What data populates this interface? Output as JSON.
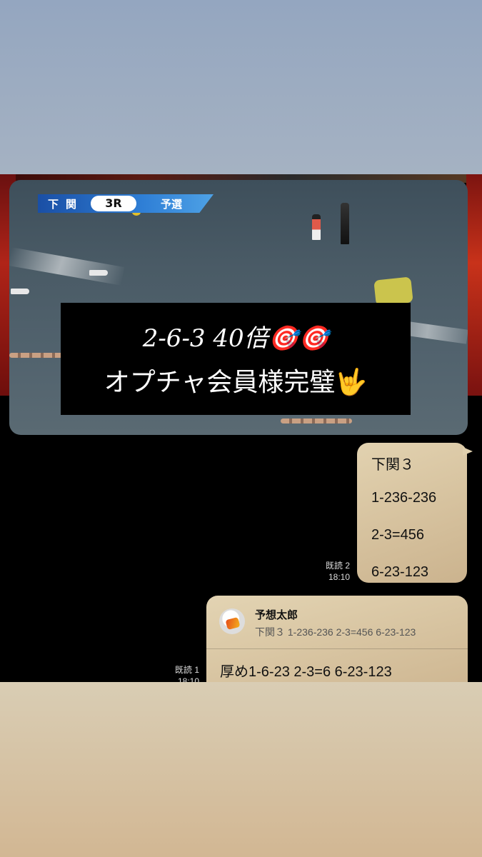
{
  "video": {
    "banner": {
      "venue": "下関",
      "race": "3R",
      "class": "予選"
    },
    "caption_line1": "2-6-3 40倍🎯🎯",
    "caption_line2": "オプチャ会員様完璧🤟"
  },
  "messages": [
    {
      "lines": [
        "下関３",
        "1-236-236",
        "2-3=456",
        "6-23-123"
      ],
      "read": "既読 2",
      "time": "18:10"
    },
    {
      "quote_name": "予想太郎",
      "quote_text": "下関３ 1-236-236 2-3=456 6-23-123",
      "text": "厚め1-6-23 2-3=6 6-23-123",
      "read": "既読 1",
      "time": "18:10"
    }
  ]
}
